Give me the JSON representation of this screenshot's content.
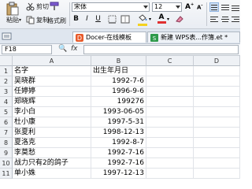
{
  "ribbon": {
    "cut_label": "剪切",
    "paste_label": "粘贴",
    "copy_label": "复制",
    "format_painter_label": "格式刷",
    "font_name": "宋体",
    "font_size": "12",
    "bold": "B",
    "italic": "I",
    "underline": "U",
    "accent_color": "#2b6fc2",
    "font_color_bar": "#e03030",
    "fill_color_bar": "#f4d21f"
  },
  "tabs": [
    {
      "label": "Docer-在线模板",
      "active": true,
      "icon": "docer-icon"
    },
    {
      "label": "新建 WPS表...作簿.et *",
      "active": false,
      "icon": "spreadsheet-icon"
    }
  ],
  "formula_bar": {
    "name_box": "F18",
    "fx_label": "fx",
    "content": ""
  },
  "columns": [
    "A",
    "B",
    "C",
    "D"
  ],
  "rows": [
    {
      "num": "1",
      "a": "名字",
      "b": "出生年月日",
      "b_align": "left"
    },
    {
      "num": "2",
      "a": "吴晓群",
      "b": "1992-7-6",
      "b_align": "right"
    },
    {
      "num": "3",
      "a": "任婷婷",
      "b": "1996-9-6",
      "b_align": "right"
    },
    {
      "num": "4",
      "a": "郑晓辉",
      "b": "199276",
      "b_align": "right"
    },
    {
      "num": "5",
      "a": "李小白",
      "b": "1993-06-05",
      "b_align": "right"
    },
    {
      "num": "6",
      "a": "杜小康",
      "b": "1997-5-31",
      "b_align": "right"
    },
    {
      "num": "7",
      "a": "张夏利",
      "b": "1998-12-13",
      "b_align": "right"
    },
    {
      "num": "8",
      "a": "夏洛克",
      "b": "1992-8-7",
      "b_align": "right"
    },
    {
      "num": "9",
      "a": "李莫愁",
      "b": "1992-7-16",
      "b_align": "right"
    },
    {
      "num": "10",
      "a": "战力只有2的鸽子",
      "b": "1992-7-16",
      "b_align": "right"
    },
    {
      "num": "11",
      "a": "单小姝",
      "b": "1997-12-13",
      "b_align": "right"
    }
  ]
}
